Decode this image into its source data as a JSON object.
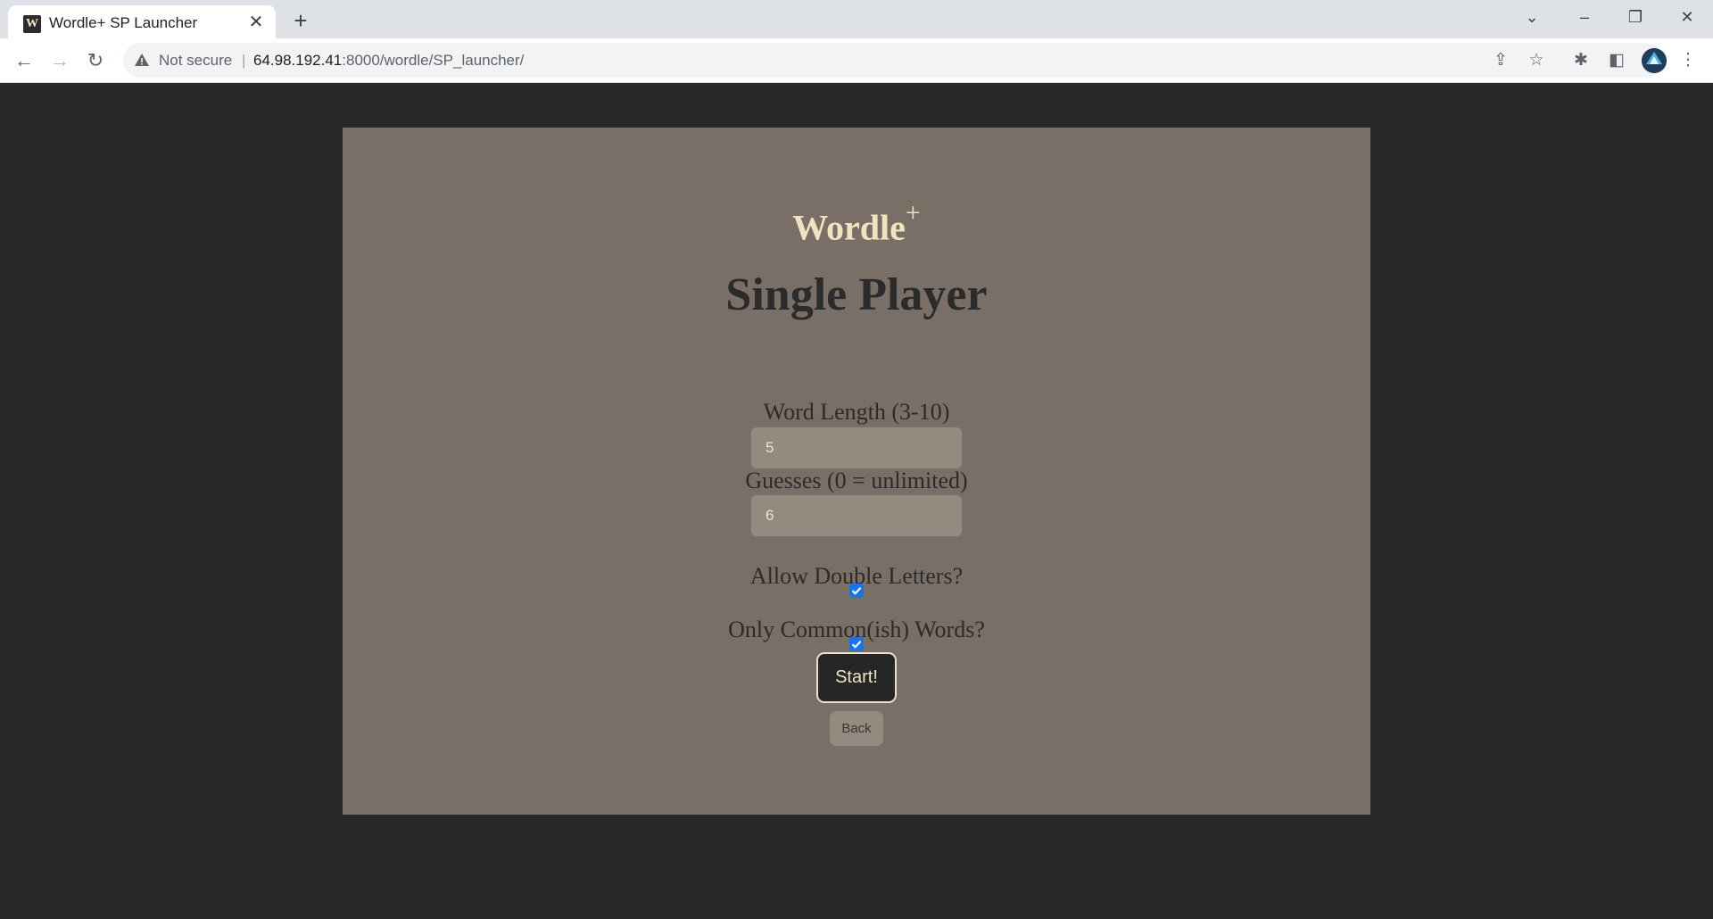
{
  "browser": {
    "tab_title": "Wordle+ SP Launcher",
    "tab_favicon_text": "W",
    "security_label": "Not secure",
    "url_host": "64.98.192.41",
    "url_rest": ":8000/wordle/SP_launcher/"
  },
  "app": {
    "logo_text": "Wordle",
    "logo_sup": "+",
    "title": "Single Player",
    "word_length": {
      "label": "Word Length (3-10)",
      "value": "5"
    },
    "guesses": {
      "label": "Guesses (0 = unlimited)",
      "value": "6"
    },
    "double_letters": {
      "label": "Allow Double Letters?",
      "checked": true
    },
    "common_words": {
      "label": "Only Common(ish) Words?",
      "checked": true
    },
    "start_label": "Start!",
    "back_label": "Back"
  },
  "colors": {
    "page_bg": "#282828",
    "card_bg": "#7a6f66",
    "accent_text": "#f0e3c0",
    "input_bg": "#958a80",
    "checkbox": "#1a73e8"
  }
}
